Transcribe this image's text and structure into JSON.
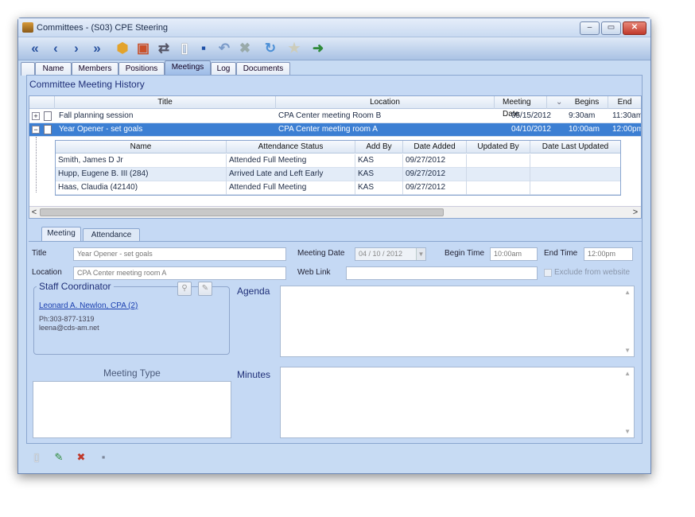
{
  "window": {
    "title": "Committees - (S03) CPE Steering",
    "min_label": "–",
    "max_label": "▭",
    "close_label": "✕"
  },
  "toolbar": {
    "icons": [
      "«",
      "‹",
      "›",
      "»",
      "⬢",
      "▣",
      "⇄",
      "▯",
      "▪",
      "↶",
      "✖",
      "↻",
      "★",
      "➜"
    ]
  },
  "tabs": [
    {
      "label": "Name"
    },
    {
      "label": "Members"
    },
    {
      "label": "Positions"
    },
    {
      "label": "Meetings"
    },
    {
      "label": "Log"
    },
    {
      "label": "Documents"
    }
  ],
  "history": {
    "title": "Committee Meeting History",
    "columns": [
      "Title",
      "Location",
      "Meeting Date",
      "Begins",
      "End"
    ],
    "sort_icon": "⌄",
    "rows": [
      {
        "expander": "+",
        "title": "Fall planning session",
        "location": "CPA Center meeting Room B",
        "date": "05/15/2012",
        "begins": "9:30am",
        "end": "11:30am"
      },
      {
        "expander": "−",
        "title": "Year Opener - set goals",
        "location": "CPA Center meeting room A",
        "date": "04/10/2012",
        "begins": "10:00am",
        "end": "12:00pm"
      }
    ],
    "sub_columns": [
      "Name",
      "Attendance Status",
      "Add By",
      "Date Added",
      "Updated By",
      "Date Last Updated"
    ],
    "sub_rows": [
      {
        "name": "Smith, James D Jr",
        "status": "Attended Full Meeting",
        "add_by": "KAS",
        "date_added": "09/27/2012",
        "updated_by": "",
        "date_updated": ""
      },
      {
        "name": "Hupp, Eugene B. III (284)",
        "status": "Arrived Late and Left Early",
        "add_by": "KAS",
        "date_added": "09/27/2012",
        "updated_by": "",
        "date_updated": ""
      },
      {
        "name": "Haas, Claudia (42140)",
        "status": "Attended Full Meeting",
        "add_by": "KAS",
        "date_added": "09/27/2012",
        "updated_by": "",
        "date_updated": ""
      }
    ],
    "scroll_left": "<",
    "scroll_right": ">"
  },
  "detail_tabs": [
    {
      "label": "Meeting"
    },
    {
      "label": "Attendance"
    }
  ],
  "meeting": {
    "title_label": "Title",
    "title_value": "Year Opener - set goals",
    "location_label": "Location",
    "location_value": "CPA Center meeting room A",
    "meeting_date_label": "Meeting Date",
    "meeting_date_value": "04 / 10 / 2012",
    "begin_time_label": "Begin Time",
    "begin_time_value": "10:00am",
    "end_time_label": "End Time",
    "end_time_value": "12:00pm",
    "web_link_label": "Web Link",
    "web_link_value": "",
    "exclude_label": "Exclude from website",
    "staff_coordinator_label": "Staff Coordinator",
    "coordinator_name": "Leonard A. Newlon, CPA (2)",
    "coordinator_phone": "Ph:303-877-1319",
    "coordinator_email": "leena@cds-am.net",
    "agenda_label": "Agenda",
    "minutes_label": "Minutes",
    "meeting_type_label": "Meeting Type"
  },
  "footer": {
    "icons": [
      "▯",
      "✎",
      "✖",
      "▪"
    ]
  }
}
